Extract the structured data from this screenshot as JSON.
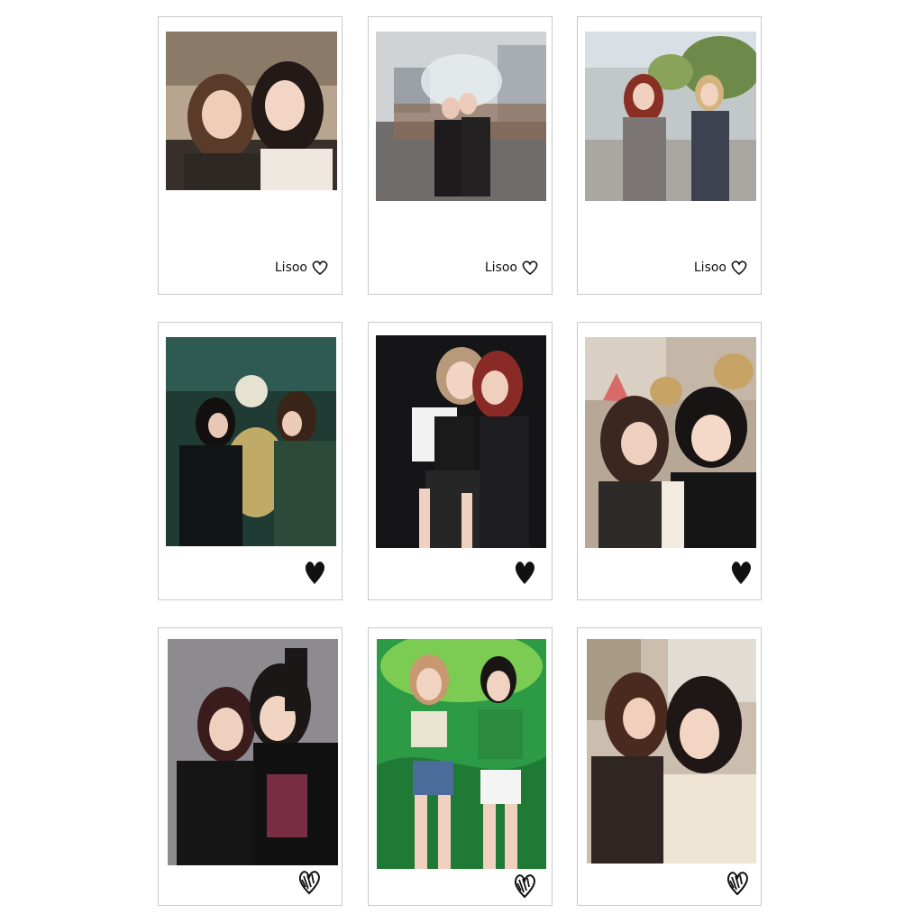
{
  "cards": [
    {
      "caption": "Lisoo",
      "scene": "two-girls-selfie-indoor",
      "heart": "outline-heart-icon"
    },
    {
      "caption": "Lisoo",
      "scene": "two-girls-umbrella-bridge",
      "heart": "outline-heart-icon"
    },
    {
      "caption": "Lisoo",
      "scene": "two-girls-walking-street",
      "heart": "outline-heart-icon"
    },
    {
      "caption": "",
      "scene": "two-girls-night-lights",
      "heart": "filled-heart-icon"
    },
    {
      "caption": "",
      "scene": "two-girls-stage-microphones",
      "heart": "filled-heart-icon"
    },
    {
      "caption": "",
      "scene": "two-girls-animal-ear-headbands",
      "heart": "filled-heart-icon"
    },
    {
      "caption": "",
      "scene": "two-girls-grey-backdrop",
      "heart": "scribble-heart-icon"
    },
    {
      "caption": "",
      "scene": "two-girls-green-stage-bottles",
      "heart": "scribble-heart-icon"
    },
    {
      "caption": "",
      "scene": "two-girls-selfie-outdoor",
      "heart": "scribble-heart-icon"
    }
  ],
  "colors": {
    "card_border": "#c9c9c9",
    "ink": "#111111"
  }
}
